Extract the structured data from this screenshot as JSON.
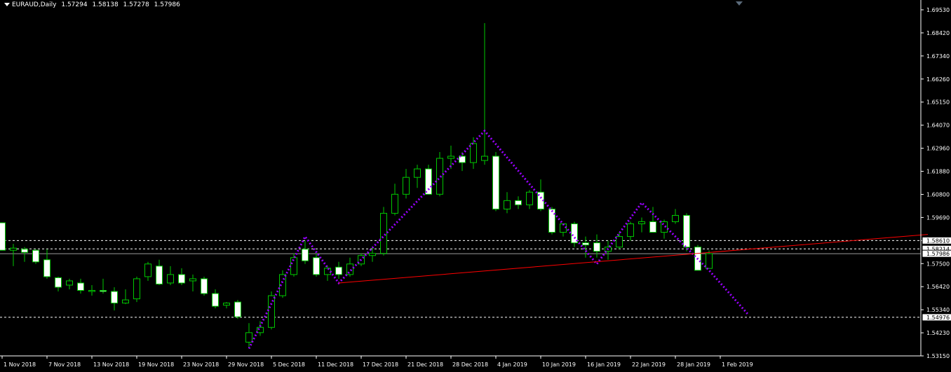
{
  "header": {
    "symbol": "EURAUD,Daily",
    "open": "1.57294",
    "high": "1.58138",
    "low": "1.57278",
    "close": "1.57986"
  },
  "colors": {
    "background": "#000000",
    "bull_candle": "#000000",
    "bear_candle": "#ffffff",
    "wick": "#00c800",
    "pattern_line": "#9900ff",
    "trend_line": "#ff0000",
    "level_line": "#ffffff",
    "axis": "#ffffff"
  },
  "chart_data": {
    "type": "candlestick",
    "symbol": "EURAUD",
    "timeframe": "Daily",
    "ylim": [
      1.5315,
      1.6953
    ],
    "y_ticks": [
      "1.69530",
      "1.68420",
      "1.67340",
      "1.66260",
      "1.65150",
      "1.64070",
      "1.62960",
      "1.61880",
      "1.60800",
      "1.59690",
      "1.58610",
      "1.57500",
      "1.56420",
      "1.55340",
      "1.54230",
      "1.53150"
    ],
    "x_ticks": [
      "1 Nov 2018",
      "7 Nov 2018",
      "13 Nov 2018",
      "19 Nov 2018",
      "23 Nov 2018",
      "29 Nov 2018",
      "5 Dec 2018",
      "11 Dec 2018",
      "17 Dec 2018",
      "21 Dec 2018",
      "28 Dec 2018",
      "4 Jan 2019",
      "10 Jan 2019",
      "16 Jan 2019",
      "22 Jan 2019",
      "28 Jan 2019",
      "1 Feb 2019"
    ],
    "candles": [
      [
        1.5945,
        1.5945,
        1.5815,
        1.5815
      ],
      [
        1.5815,
        1.5845,
        1.574,
        1.5825
      ],
      [
        1.582,
        1.583,
        1.576,
        1.5805
      ],
      [
        1.5815,
        1.582,
        1.575,
        1.576
      ],
      [
        1.577,
        1.582,
        1.568,
        1.569
      ],
      [
        1.5685,
        1.569,
        1.562,
        1.564
      ],
      [
        1.565,
        1.568,
        1.563,
        1.567
      ],
      [
        1.566,
        1.568,
        1.561,
        1.5625
      ],
      [
        1.562,
        1.565,
        1.56,
        1.5625
      ],
      [
        1.5625,
        1.568,
        1.561,
        1.562
      ],
      [
        1.562,
        1.564,
        1.553,
        1.5565
      ],
      [
        1.5565,
        1.563,
        1.556,
        1.558
      ],
      [
        1.5585,
        1.569,
        1.557,
        1.568
      ],
      [
        1.569,
        1.576,
        1.567,
        1.575
      ],
      [
        1.574,
        1.577,
        1.565,
        1.5655
      ],
      [
        1.566,
        1.574,
        1.565,
        1.57
      ],
      [
        1.57,
        1.573,
        1.565,
        1.566
      ],
      [
        1.567,
        1.57,
        1.562,
        1.568
      ],
      [
        1.568,
        1.569,
        1.56,
        1.561
      ],
      [
        1.561,
        1.563,
        1.554,
        1.555
      ],
      [
        1.5555,
        1.557,
        1.554,
        1.5565
      ],
      [
        1.557,
        1.558,
        1.549,
        1.55
      ],
      [
        1.538,
        1.547,
        1.535,
        1.5425
      ],
      [
        1.5425,
        1.548,
        1.541,
        1.545
      ],
      [
        1.545,
        1.562,
        1.544,
        1.56
      ],
      [
        1.56,
        1.572,
        1.559,
        1.57
      ],
      [
        1.57,
        1.58,
        1.569,
        1.578
      ],
      [
        1.582,
        1.586,
        1.575,
        1.5765
      ],
      [
        1.578,
        1.58,
        1.569,
        1.57
      ],
      [
        1.57,
        1.574,
        1.567,
        1.573
      ],
      [
        1.5735,
        1.576,
        1.568,
        1.57
      ],
      [
        1.57,
        1.578,
        1.569,
        1.575
      ],
      [
        1.575,
        1.58,
        1.574,
        1.579
      ],
      [
        1.579,
        1.583,
        1.576,
        1.58
      ],
      [
        1.58,
        1.602,
        1.579,
        1.599
      ],
      [
        1.599,
        1.613,
        1.598,
        1.608
      ],
      [
        1.608,
        1.62,
        1.606,
        1.616
      ],
      [
        1.616,
        1.622,
        1.611,
        1.62
      ],
      [
        1.62,
        1.622,
        1.608,
        1.608
      ],
      [
        1.608,
        1.628,
        1.607,
        1.625
      ],
      [
        1.625,
        1.631,
        1.62,
        1.626
      ],
      [
        1.626,
        1.628,
        1.619,
        1.623
      ],
      [
        1.623,
        1.635,
        1.62,
        1.632
      ],
      [
        1.624,
        1.689,
        1.622,
        1.626
      ],
      [
        1.626,
        1.628,
        1.6,
        1.601
      ],
      [
        1.601,
        1.609,
        1.599,
        1.605
      ],
      [
        1.605,
        1.607,
        1.601,
        1.603
      ],
      [
        1.603,
        1.61,
        1.601,
        1.609
      ],
      [
        1.609,
        1.615,
        1.6,
        1.601
      ],
      [
        1.601,
        1.602,
        1.589,
        1.59
      ],
      [
        1.59,
        1.594,
        1.588,
        1.594
      ],
      [
        1.594,
        1.595,
        1.583,
        1.585
      ],
      [
        1.585,
        1.588,
        1.578,
        1.584
      ],
      [
        1.585,
        1.589,
        1.578,
        1.581
      ],
      [
        1.581,
        1.586,
        1.577,
        1.583
      ],
      [
        1.583,
        1.59,
        1.582,
        1.588
      ],
      [
        1.588,
        1.595,
        1.586,
        1.594
      ],
      [
        1.594,
        1.597,
        1.59,
        1.595
      ],
      [
        1.595,
        1.602,
        1.59,
        1.59
      ],
      [
        1.59,
        1.596,
        1.587,
        1.595
      ],
      [
        1.595,
        1.601,
        1.594,
        1.598
      ],
      [
        1.598,
        1.599,
        1.581,
        1.583
      ],
      [
        1.583,
        1.584,
        1.572,
        1.572
      ],
      [
        1.5729,
        1.5814,
        1.5728,
        1.5799
      ]
    ],
    "zigzag": [
      [
        22,
        1.535
      ],
      [
        27,
        1.588
      ],
      [
        30,
        1.566
      ],
      [
        43,
        1.638
      ],
      [
        53,
        1.575
      ],
      [
        57,
        1.604
      ],
      [
        63,
        1.572
      ],
      [
        66.5,
        1.551
      ]
    ],
    "trend_line": [
      [
        30,
        1.566
      ],
      [
        82.5,
        1.589
      ]
    ],
    "levels": [
      "1.58610",
      "1.58214",
      "1.54976"
    ],
    "current_price": "1.57986",
    "annotations": [
      "1.57986"
    ]
  }
}
